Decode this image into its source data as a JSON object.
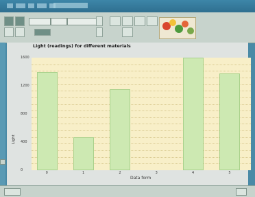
{
  "app": {
    "toolbar": {
      "name_field_value": "",
      "size_field_value": ""
    },
    "status": {
      "page_label": ""
    }
  },
  "chart_data": {
    "type": "bar",
    "title": "Light (readings) for different materials",
    "xlabel": "Data form",
    "ylabel": "Light",
    "categories": [
      "0",
      "1",
      "2",
      "3",
      "4",
      "5"
    ],
    "values": [
      1400,
      470,
      1150,
      0,
      1600,
      1380
    ],
    "ylim": [
      0,
      1600
    ],
    "yticks": [
      "0",
      "400",
      "800",
      "1200",
      "1600"
    ],
    "grid": true,
    "colors": {
      "bar": "#cde9b2",
      "plot_background": "#f8efc8"
    }
  }
}
